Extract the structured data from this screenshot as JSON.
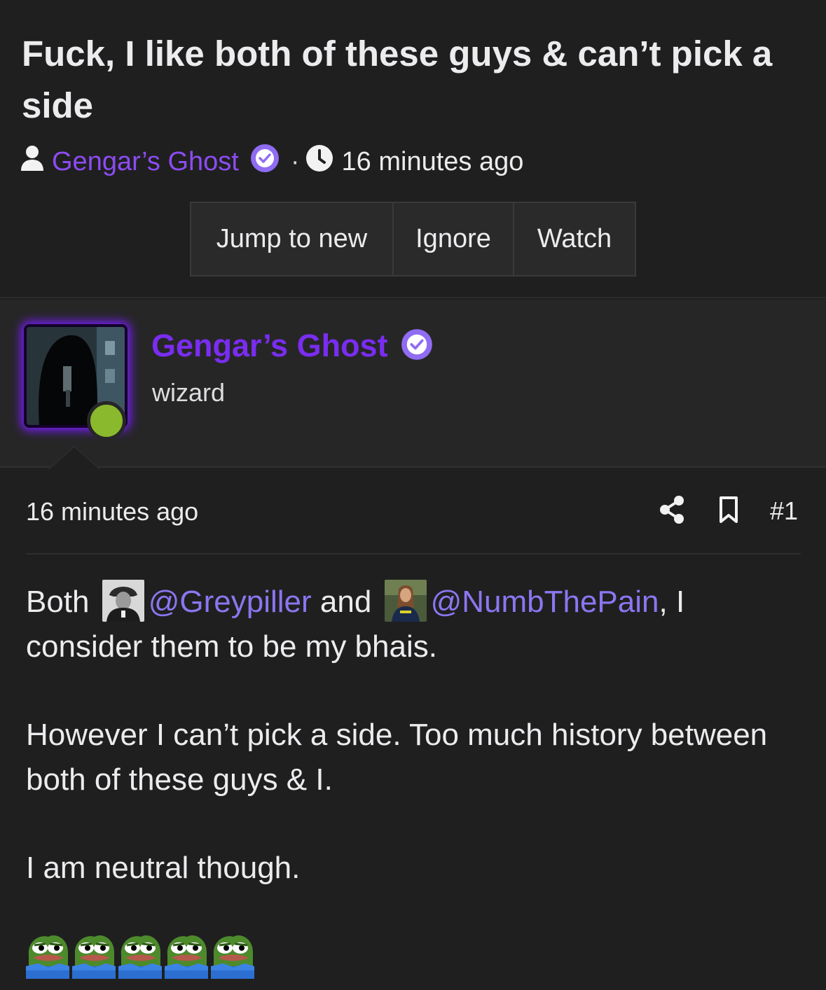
{
  "thread": {
    "title": "Fuck, I like both of these guys & can’t pick a side",
    "author": "Gengar’s Ghost",
    "separator": "·",
    "time": "16 minutes ago"
  },
  "actions": {
    "jump_to_new": "Jump to new",
    "ignore": "Ignore",
    "watch": "Watch"
  },
  "post": {
    "username": "Gengar’s Ghost",
    "user_title": "wizard",
    "time": "16 minutes ago",
    "number": "#1",
    "body": {
      "p1_a": "Both",
      "mention1": "@Greypiller",
      "p1_b": "and",
      "mention2": "@NumbThePain",
      "p1_c": ", I consider them to be my bhais.",
      "p2": "However I can’t pick a side. Too much history between both of these guys & I.",
      "p3": "I am neutral though."
    },
    "reaction_count": 5
  },
  "colors": {
    "accent": "#7a2df0",
    "badge": "#8f6cf2",
    "mention": "#8c76f0",
    "online": "#8bb92d",
    "background": "#1f1f20"
  },
  "icons": [
    "user-icon",
    "verified-badge-icon",
    "clock-icon",
    "share-icon",
    "bookmark-icon",
    "pepe-emoji"
  ]
}
